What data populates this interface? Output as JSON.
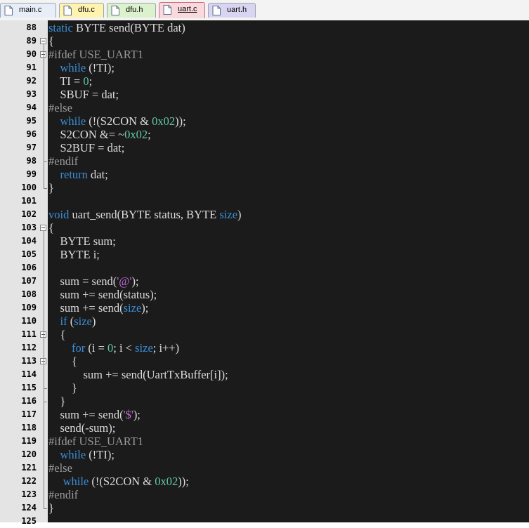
{
  "tabs": [
    {
      "label": "main.c",
      "active": false,
      "color": "#e8eef8",
      "icon": "file-c-icon"
    },
    {
      "label": "dfu.c",
      "active": false,
      "color": "#fff3b0",
      "icon": "file-c-icon"
    },
    {
      "label": "dfu.h",
      "active": false,
      "color": "#dbf2cc",
      "icon": "file-h-icon"
    },
    {
      "label": "uart.c",
      "active": true,
      "color": "#f9d9dd",
      "icon": "file-c-icon"
    },
    {
      "label": "uart.h",
      "active": false,
      "color": "#d9d4f2",
      "icon": "file-h-icon"
    }
  ],
  "editor": {
    "first_line_number": 88,
    "lines": [
      {
        "n": "88",
        "t": [
          [
            "kw",
            "static"
          ],
          [
            "pl",
            " BYTE send(BYTE dat)"
          ]
        ]
      },
      {
        "n": "89",
        "t": [
          [
            "pl",
            "{"
          ]
        ]
      },
      {
        "n": "90",
        "t": [
          [
            "pp",
            "#ifdef USE_UART1"
          ]
        ]
      },
      {
        "n": "91",
        "t": [
          [
            "pl",
            "    "
          ],
          [
            "kw",
            "while"
          ],
          [
            "pl",
            " (!TI);"
          ]
        ]
      },
      {
        "n": "92",
        "t": [
          [
            "pl",
            "    TI = "
          ],
          [
            "num",
            "0"
          ],
          [
            "pl",
            ";"
          ]
        ]
      },
      {
        "n": "93",
        "t": [
          [
            "pl",
            "    SBUF = dat;"
          ]
        ]
      },
      {
        "n": "94",
        "t": [
          [
            "pp",
            "#else"
          ]
        ]
      },
      {
        "n": "95",
        "t": [
          [
            "pl",
            "    "
          ],
          [
            "kw",
            "while"
          ],
          [
            "pl",
            " (!(S2CON & "
          ],
          [
            "num",
            "0x02"
          ],
          [
            "pl",
            "));"
          ]
        ]
      },
      {
        "n": "96",
        "t": [
          [
            "pl",
            "    S2CON &= ~"
          ],
          [
            "num",
            "0x02"
          ],
          [
            "pl",
            ";"
          ]
        ]
      },
      {
        "n": "97",
        "t": [
          [
            "pl",
            "    S2BUF = dat;"
          ]
        ]
      },
      {
        "n": "98",
        "t": [
          [
            "pp",
            "#endif"
          ]
        ]
      },
      {
        "n": "99",
        "t": [
          [
            "pl",
            "    "
          ],
          [
            "kw",
            "return"
          ],
          [
            "pl",
            " dat;"
          ]
        ]
      },
      {
        "n": "100",
        "t": [
          [
            "pl",
            "}"
          ]
        ]
      },
      {
        "n": "101",
        "t": []
      },
      {
        "n": "102",
        "t": [
          [
            "kw",
            "void"
          ],
          [
            "pl",
            " uart_send(BYTE status, BYTE "
          ],
          [
            "kw",
            "size"
          ],
          [
            "pl",
            ")"
          ]
        ]
      },
      {
        "n": "103",
        "t": [
          [
            "pl",
            "{"
          ]
        ]
      },
      {
        "n": "104",
        "t": [
          [
            "pl",
            "    BYTE sum;"
          ]
        ]
      },
      {
        "n": "105",
        "t": [
          [
            "pl",
            "    BYTE i;"
          ]
        ]
      },
      {
        "n": "106",
        "t": []
      },
      {
        "n": "107",
        "t": [
          [
            "pl",
            "    sum = send("
          ],
          [
            "str",
            "'@'"
          ],
          [
            "pl",
            ");"
          ]
        ]
      },
      {
        "n": "108",
        "t": [
          [
            "pl",
            "    sum += send(status);"
          ]
        ]
      },
      {
        "n": "109",
        "t": [
          [
            "pl",
            "    sum += send("
          ],
          [
            "kw",
            "size"
          ],
          [
            "pl",
            ");"
          ]
        ]
      },
      {
        "n": "110",
        "t": [
          [
            "pl",
            "    "
          ],
          [
            "kw",
            "if"
          ],
          [
            "pl",
            " ("
          ],
          [
            "kw",
            "size"
          ],
          [
            "pl",
            ")"
          ]
        ]
      },
      {
        "n": "111",
        "t": [
          [
            "pl",
            "    {"
          ]
        ]
      },
      {
        "n": "112",
        "t": [
          [
            "pl",
            "        "
          ],
          [
            "kw",
            "for"
          ],
          [
            "pl",
            " (i = "
          ],
          [
            "num",
            "0"
          ],
          [
            "pl",
            "; i < "
          ],
          [
            "kw",
            "size"
          ],
          [
            "pl",
            "; i++)"
          ]
        ]
      },
      {
        "n": "113",
        "t": [
          [
            "pl",
            "        {"
          ]
        ]
      },
      {
        "n": "114",
        "t": [
          [
            "pl",
            "            sum += send(UartTxBuffer[i]);"
          ]
        ]
      },
      {
        "n": "115",
        "t": [
          [
            "pl",
            "        }"
          ]
        ]
      },
      {
        "n": "116",
        "t": [
          [
            "pl",
            "    }"
          ]
        ]
      },
      {
        "n": "117",
        "t": [
          [
            "pl",
            "    sum += send("
          ],
          [
            "str",
            "'$'"
          ],
          [
            "pl",
            ");"
          ]
        ]
      },
      {
        "n": "118",
        "t": [
          [
            "pl",
            "    send(-sum);"
          ]
        ]
      },
      {
        "n": "119",
        "t": [
          [
            "pp",
            "#ifdef USE_UART1"
          ]
        ]
      },
      {
        "n": "120",
        "t": [
          [
            "pl",
            "    "
          ],
          [
            "kw",
            "while"
          ],
          [
            "pl",
            " (!TI);"
          ]
        ]
      },
      {
        "n": "121",
        "t": [
          [
            "pp",
            "#else"
          ]
        ]
      },
      {
        "n": "122",
        "t": [
          [
            "pl",
            "     "
          ],
          [
            "kw",
            "while"
          ],
          [
            "pl",
            " (!(S2CON & "
          ],
          [
            "num",
            "0x02"
          ],
          [
            "pl",
            "));"
          ]
        ]
      },
      {
        "n": "123",
        "t": [
          [
            "pp",
            "#endif"
          ]
        ]
      },
      {
        "n": "124",
        "t": [
          [
            "pl",
            "}"
          ]
        ]
      },
      {
        "n": "125",
        "t": []
      }
    ]
  },
  "colors": {
    "background": "#1b1b1b",
    "keyword": "#3b8ed8",
    "preprocessor": "#9a9a9a",
    "number": "#63c7a8",
    "string": "#c06bd6",
    "text": "#dcdcdc",
    "gutter": "#e4e4e4"
  }
}
